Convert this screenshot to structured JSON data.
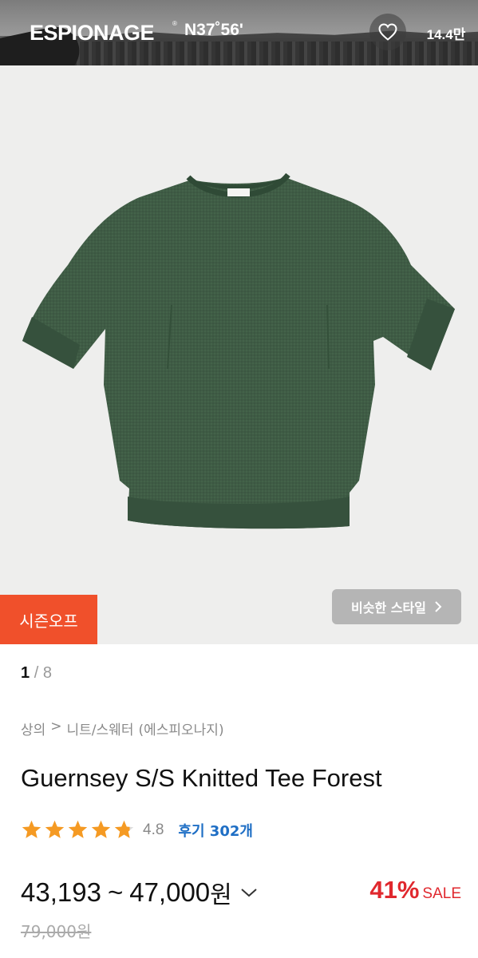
{
  "banner": {
    "brand_name": "ESPIONAGE",
    "brand_reg_mark": "®",
    "brand_sub": "N37˚56'",
    "like_icon": "heart-outline-icon",
    "like_count": "14.4만"
  },
  "image": {
    "season_badge": "시즌오프",
    "similar_style_label": "비슷한 스타일",
    "similar_style_icon": "chevron-right-icon",
    "product_color": "#3f5c45"
  },
  "pagination": {
    "current": "1",
    "separator": "/",
    "total": "8"
  },
  "breadcrumb": {
    "category": "상의",
    "separator": ">",
    "subcategory": "니트/스웨터",
    "brand": "(에스피오나지)"
  },
  "product": {
    "title": "Guernsey S/S Knitted Tee Forest",
    "rating": 4.8,
    "rating_text": "4.8",
    "review_label": "후기 302개",
    "star_color": "#f59a23",
    "price_min": "43,193",
    "price_sep": "~",
    "price_max": "47,000",
    "price_unit": "원",
    "discount_rate": "41%",
    "sale_label": "SALE",
    "original_price": "79,000원",
    "accent_color": "#e0282e"
  }
}
